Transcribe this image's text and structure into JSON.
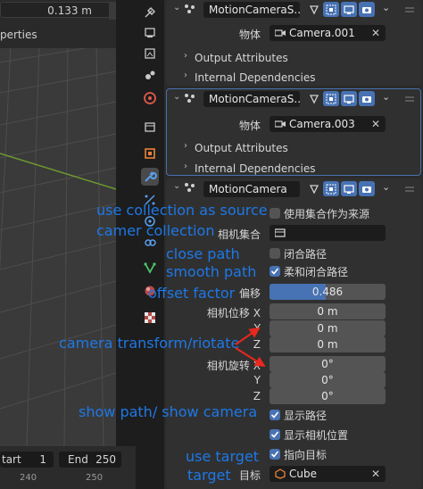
{
  "viewport": {
    "dimension_value": "0.133 m",
    "properties_label": "perties"
  },
  "timeline": {
    "start_label": "tart",
    "start_value": "1",
    "end_label": "End",
    "end_value": "250",
    "ticks": [
      "240",
      "250"
    ]
  },
  "modifiers": [
    {
      "name": "MotionCameraS...",
      "object_label": "物体",
      "object_value": "Camera.001",
      "output_attributes": "Output Attributes",
      "internal_dependencies": "Internal Dependencies"
    },
    {
      "name": "MotionCameraS...",
      "object_label": "物体",
      "object_value": "Camera.003",
      "output_attributes": "Output Attributes",
      "internal_dependencies": "Internal Dependencies"
    },
    {
      "name": "MotionCamera",
      "use_collection_label": "使用集合作为来源",
      "camera_collection_label": "相机集合",
      "close_path_label": "闭合路径",
      "smooth_path_label": "柔和闭合路径",
      "offset_label": "偏移",
      "offset_value": "0.486",
      "offset_fraction": 0.486,
      "camera_location_label": "相机位移",
      "location_x": "0 m",
      "location_y": "0 m",
      "location_z": "0 m",
      "camera_rotation_label": "相机旋转",
      "rotation_x": "0°",
      "rotation_y": "0°",
      "rotation_z": "0°",
      "axis_x": "X",
      "axis_y": "Y",
      "axis_z": "Z",
      "show_path_label": "显示路径",
      "show_camera_label": "显示相机位置",
      "point_target_label": "指向目标",
      "target_label": "目标",
      "target_value": "Cube"
    }
  ],
  "annotations": {
    "use_collection": "use collection as source",
    "camera_collection": "camer collection",
    "close_path": "close path",
    "smooth_path": "smooth path",
    "offset_factor": "offset factor",
    "camera_transform": "camera transform/riotate",
    "show_path": "show path/ show camera",
    "use_target": "use target",
    "target": "target"
  },
  "colors": {
    "accent": "#4772b3",
    "annotation": "#1e78e6",
    "arrow": "#e8281e",
    "grid_green": "#6e9a2e"
  }
}
